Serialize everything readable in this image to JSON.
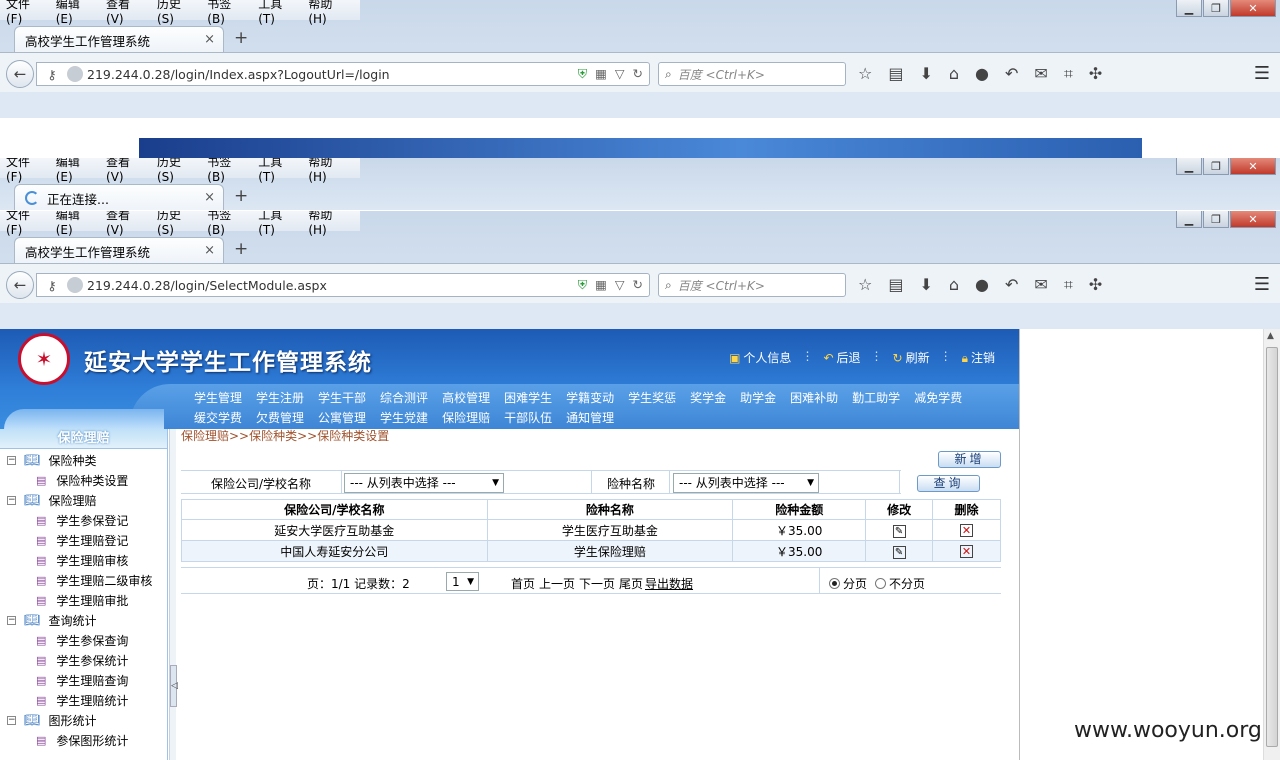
{
  "browser": {
    "menu": [
      "文件(F)",
      "编辑(E)",
      "查看(V)",
      "历史(S)",
      "书签(B)",
      "工具(T)",
      "帮助(H)"
    ],
    "window1": {
      "tab_title": "高校学生工作管理系统",
      "url": "219.244.0.28/login/Index.aspx?LogoutUrl=/login"
    },
    "window2": {
      "tab_title": "正在连接..."
    },
    "window3": {
      "tab_title": "高校学生工作管理系统",
      "url": "219.244.0.28/login/SelectModule.aspx"
    },
    "search_placeholder": "百度 <Ctrl+K>",
    "new_tab": "+",
    "close_tab": "×"
  },
  "app": {
    "title": "延安大学学生工作管理系统",
    "top_links": [
      "个人信息",
      "后退",
      "刷新",
      "注销"
    ],
    "modules_row1": [
      "学生管理",
      "学生注册",
      "学生干部",
      "综合测评",
      "高校管理",
      "困难学生",
      "学籍变动",
      "学生奖惩",
      "奖学金",
      "助学金",
      "困难补助",
      "勤工助学",
      "减免学费"
    ],
    "modules_row2": [
      "缓交学费",
      "欠费管理",
      "公寓管理",
      "学生党建",
      "保险理赔",
      "干部队伍",
      "通知管理"
    ]
  },
  "sidebar": {
    "title": "保险理赔",
    "groups": [
      {
        "label": "保险种类",
        "items": [
          "保险种类设置"
        ]
      },
      {
        "label": "保险理赔",
        "items": [
          "学生参保登记",
          "学生理赔登记",
          "学生理赔审核",
          "学生理赔二级审核",
          "学生理赔审批"
        ]
      },
      {
        "label": "查询统计",
        "items": [
          "学生参保查询",
          "学生参保统计",
          "学生理赔查询",
          "学生理赔统计"
        ]
      },
      {
        "label": "图形统计",
        "items": [
          "参保图形统计"
        ]
      }
    ]
  },
  "main": {
    "breadcrumb": "保险理赔>>保险种类>>保险种类设置",
    "add_button": "新增",
    "query_button": "查询",
    "filter": {
      "company_label": "保险公司/学校名称",
      "company_value": "--- 从列表中选择 ---",
      "insurance_label": "险种名称",
      "insurance_value": "--- 从列表中选择 ---"
    },
    "table": {
      "headers": [
        "保险公司/学校名称",
        "险种名称",
        "险种金额",
        "修改",
        "删除"
      ],
      "rows": [
        [
          "延安大学医疗互助基金",
          "学生医疗互助基金",
          "￥35.00"
        ],
        [
          "中国人寿延安分公司",
          "学生保险理赔",
          "￥35.00"
        ]
      ]
    },
    "pager": {
      "info": "页：1/1 记录数：2",
      "page_select": "1",
      "first": "首页",
      "prev": "上一页",
      "next": "下一页",
      "last": "尾页",
      "export": "导出数据",
      "paged": "分页",
      "unpaged": "不分页"
    }
  },
  "watermark": "www.wooyun.org"
}
